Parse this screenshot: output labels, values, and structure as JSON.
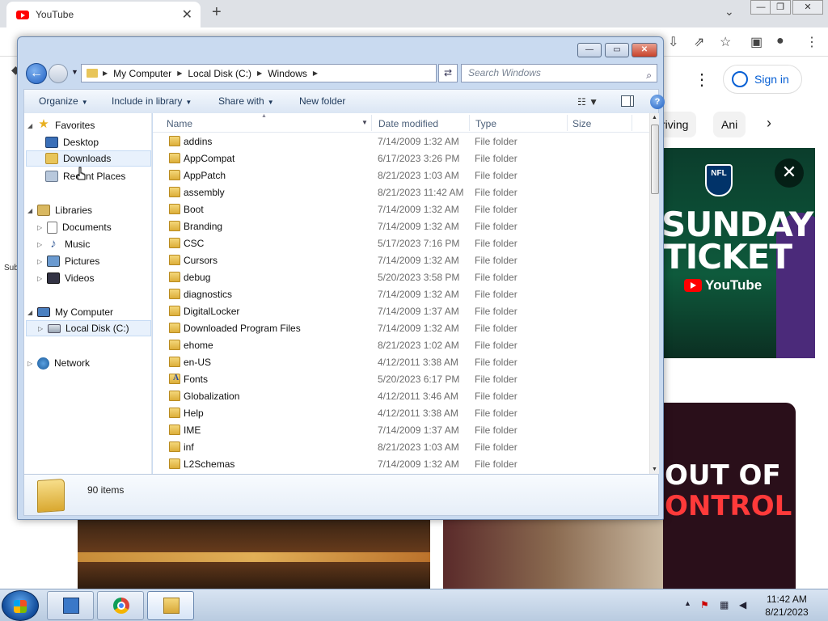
{
  "browser": {
    "tab_title": "YouTube",
    "tab_close": "✕",
    "new_tab": "+",
    "tabs_menu": "⌄",
    "win_min": "—",
    "win_max": "❐",
    "win_close": "✕"
  },
  "youtube": {
    "more": "⋮",
    "sign_in": "Sign in",
    "chips": [
      "riving",
      "Ani"
    ],
    "chip_next": "›",
    "ad": {
      "nfl": "NFL",
      "line1": "SUNDAY",
      "line2": "TICKET",
      "yt": "YouTube",
      "close": "✕"
    },
    "thumb_red": {
      "line1": "OUT OF",
      "line2": "ONTROL"
    },
    "sub_fragment": "Sub"
  },
  "explorer": {
    "win_min": "—",
    "win_max": "▭",
    "win_close": "✕",
    "breadcrumb": [
      "My Computer",
      "Local Disk (C:)",
      "Windows"
    ],
    "search_placeholder": "Search Windows",
    "commands": {
      "organize": "Organize",
      "include_in_library": "Include in library",
      "share_with": "Share with",
      "new_folder": "New folder"
    },
    "nav": {
      "favorites": "Favorites",
      "desktop": "Desktop",
      "downloads": "Downloads",
      "recent_places": "Recent Places",
      "libraries": "Libraries",
      "documents": "Documents",
      "music": "Music",
      "pictures": "Pictures",
      "videos": "Videos",
      "my_computer": "My Computer",
      "local_disk": "Local Disk (C:)",
      "network": "Network"
    },
    "columns": {
      "name": "Name",
      "date_modified": "Date modified",
      "type": "Type",
      "size": "Size"
    },
    "files": [
      {
        "name": "addins",
        "date": "7/14/2009 1:32 AM",
        "type": "File folder"
      },
      {
        "name": "AppCompat",
        "date": "6/17/2023 3:26 PM",
        "type": "File folder"
      },
      {
        "name": "AppPatch",
        "date": "8/21/2023 1:03 AM",
        "type": "File folder"
      },
      {
        "name": "assembly",
        "date": "8/21/2023 11:42 AM",
        "type": "File folder"
      },
      {
        "name": "Boot",
        "date": "7/14/2009 1:32 AM",
        "type": "File folder"
      },
      {
        "name": "Branding",
        "date": "7/14/2009 1:32 AM",
        "type": "File folder"
      },
      {
        "name": "CSC",
        "date": "5/17/2023 7:16 PM",
        "type": "File folder"
      },
      {
        "name": "Cursors",
        "date": "7/14/2009 1:32 AM",
        "type": "File folder"
      },
      {
        "name": "debug",
        "date": "5/20/2023 3:58 PM",
        "type": "File folder"
      },
      {
        "name": "diagnostics",
        "date": "7/14/2009 1:32 AM",
        "type": "File folder"
      },
      {
        "name": "DigitalLocker",
        "date": "7/14/2009 1:37 AM",
        "type": "File folder"
      },
      {
        "name": "Downloaded Program Files",
        "date": "7/14/2009 1:32 AM",
        "type": "File folder"
      },
      {
        "name": "ehome",
        "date": "8/21/2023 1:02 AM",
        "type": "File folder"
      },
      {
        "name": "en-US",
        "date": "4/12/2011 3:38 AM",
        "type": "File folder"
      },
      {
        "name": "Fonts",
        "date": "5/20/2023 6:17 PM",
        "type": "File folder",
        "icon": "fonts-folder-icon"
      },
      {
        "name": "Globalization",
        "date": "4/12/2011 3:46 AM",
        "type": "File folder"
      },
      {
        "name": "Help",
        "date": "4/12/2011 3:38 AM",
        "type": "File folder"
      },
      {
        "name": "IME",
        "date": "7/14/2009 1:37 AM",
        "type": "File folder"
      },
      {
        "name": "inf",
        "date": "8/21/2023 1:03 AM",
        "type": "File folder"
      },
      {
        "name": "L2Schemas",
        "date": "7/14/2009 1:32 AM",
        "type": "File folder"
      }
    ],
    "item_count": "90 items"
  },
  "taskbar": {
    "time": "11:42 AM",
    "date": "8/21/2023"
  },
  "colors": {
    "explorer_frame": "#c9daf0",
    "selection": "#e8f1fc",
    "youtube_red": "#ff0000",
    "link_blue": "#065fd4"
  }
}
